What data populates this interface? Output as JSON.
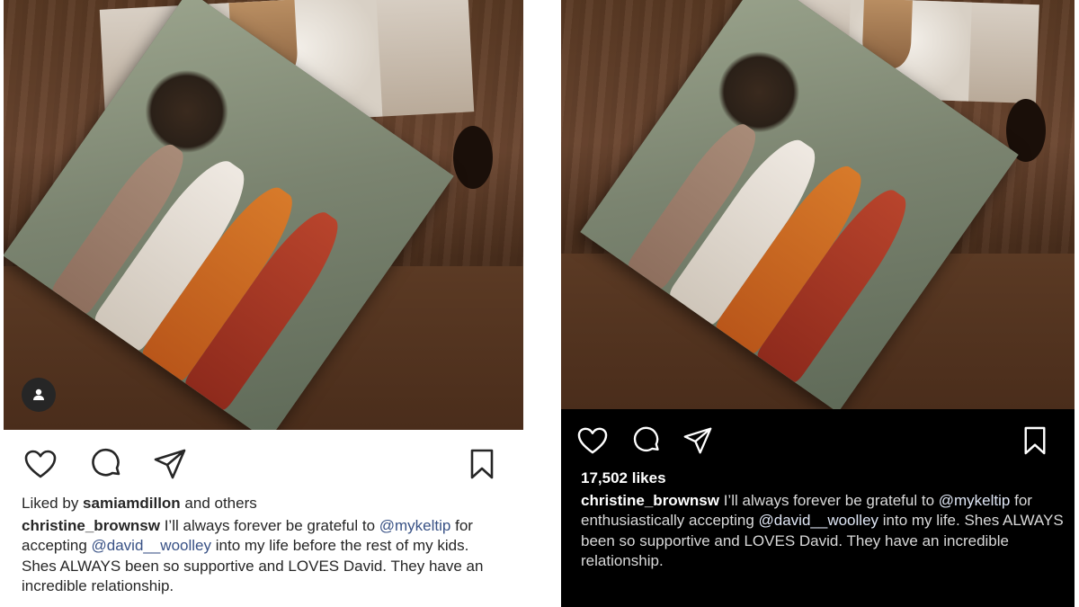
{
  "left_post": {
    "liked_by_prefix": "Liked by ",
    "liked_by_user": "samiamdillon",
    "liked_by_suffix": " and others",
    "username": "christine_brownsw",
    "caption_parts": [
      " I’ll always forever be grateful to ",
      "@mykeltip",
      " for accepting ",
      "@david__woolley",
      " into my life before the rest of my kids. Shes ALWAYS been so supportive and LOVES David. They have an incredible relationship."
    ],
    "icons": [
      "heart-icon",
      "comment-icon",
      "share-icon",
      "bookmark-icon",
      "user-tag-icon"
    ]
  },
  "right_post": {
    "likes": "17,502 likes",
    "username": "christine_brownsw",
    "caption_parts": [
      " I’ll always forever be grateful to ",
      "@mykeltip",
      " for enthusiastically accepting ",
      "@david__woolley",
      " into my life. Shes ALWAYS been so supportive and LOVES David. They have an incredible relationship."
    ],
    "icons": [
      "heart-icon",
      "comment-icon",
      "share-icon",
      "bookmark-icon"
    ]
  },
  "colors": {
    "left_background": "#ffffff",
    "right_background": "#000000",
    "mention_light": "#385185",
    "text_dark": "#262626"
  }
}
